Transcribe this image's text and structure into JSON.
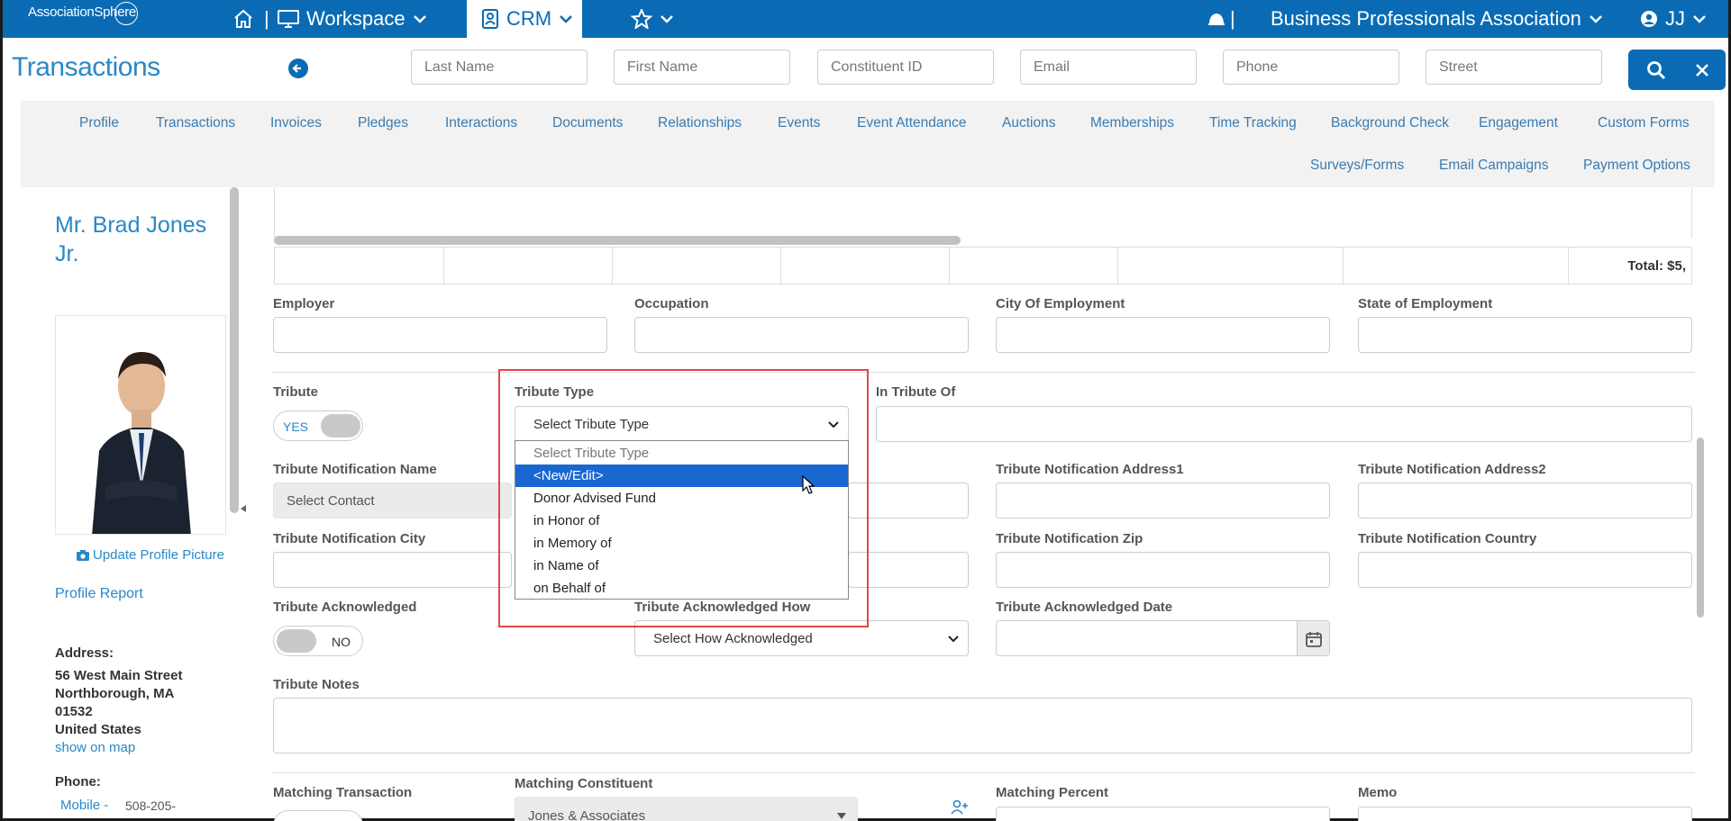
{
  "topbar": {
    "logo": "AssociationSphere",
    "workspace_label": "Workspace",
    "crm_label": "CRM",
    "org_name": "Business Professionals Association",
    "user_initials": "JJ",
    "separator": "|"
  },
  "page": {
    "title": "Transactions"
  },
  "search": {
    "last_name": "Last Name",
    "first_name": "First Name",
    "constituent_id": "Constituent ID",
    "email": "Email",
    "phone": "Phone",
    "street": "Street"
  },
  "tabs": {
    "row1": [
      "Profile",
      "Transactions",
      "Invoices",
      "Pledges",
      "Interactions",
      "Documents",
      "Relationships",
      "Events",
      "Event Attendance",
      "Auctions",
      "Memberships",
      "Time Tracking",
      "Background Check",
      "Engagement",
      "Custom Forms"
    ],
    "row2": [
      "Surveys/Forms",
      "Email Campaigns",
      "Payment Options"
    ]
  },
  "profile": {
    "name": "Mr. Brad Jones Jr.",
    "update_picture": "Update Profile Picture",
    "profile_report": "Profile Report",
    "address_label": "Address:",
    "address_line1": "56 West Main Street",
    "address_line2": "Northborough, MA",
    "address_line3": "01532",
    "address_country": "United States",
    "show_on_map": "show on map",
    "phone_label": "Phone:",
    "phone_type": "Mobile -",
    "phone_number": "508-205-"
  },
  "grid": {
    "total_label": "Total: $5,"
  },
  "form": {
    "employer": "Employer",
    "occupation": "Occupation",
    "city_of_employment": "City Of Employment",
    "state_of_employment": "State of Employment",
    "tribute": "Tribute",
    "tribute_toggle": "YES",
    "tribute_type": "Tribute Type",
    "tribute_type_selected": "Select Tribute Type",
    "in_tribute_of": "In Tribute Of",
    "notif_name": "Tribute Notification Name",
    "notif_name_value": "Select Contact",
    "notif_address1": "Tribute Notification Address1",
    "notif_address2": "Tribute Notification Address2",
    "notif_city": "Tribute Notification City",
    "notif_zip": "Tribute Notification Zip",
    "notif_country": "Tribute Notification Country",
    "acknowledged": "Tribute Acknowledged",
    "acknowledged_toggle": "NO",
    "ack_how": "Tribute Acknowledged How",
    "ack_how_selected": "Select How Acknowledged",
    "ack_date": "Tribute Acknowledged Date",
    "notes": "Tribute Notes",
    "matching_transaction": "Matching Transaction",
    "matching_constituent": "Matching Constituent",
    "matching_constituent_value": "Jones & Associates",
    "matching_percent": "Matching Percent",
    "memo": "Memo"
  },
  "dropdown": {
    "options": [
      "Select Tribute Type",
      "<New/Edit>",
      "Donor Advised Fund",
      "in Honor of",
      "in Memory of",
      "in Name of",
      "on Behalf of"
    ]
  },
  "colors": {
    "brand": "#0a6bb4",
    "link": "#2a88c6",
    "highlight": "#1a67d2",
    "annotation": "#e04848"
  }
}
